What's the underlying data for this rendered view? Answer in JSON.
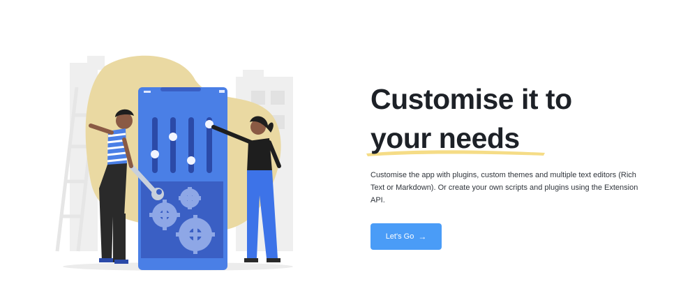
{
  "hero": {
    "heading_line1": "Customise it to",
    "heading_line2": "your needs",
    "description": "Customise the app with plugins, custom themes and multiple text editors (Rich Text or Markdown). Or create your own scripts and plugins using the Extension API.",
    "cta_label": "Let's Go",
    "cta_icon": "arrow-right-icon"
  },
  "illustration": {
    "subject": "two people adjusting slider controls and gears on a giant phone",
    "icons": [
      "phone-icon",
      "slider-icon",
      "gear-icon",
      "wrench-icon"
    ]
  },
  "colors": {
    "accent": "#4a9cf7",
    "highlight": "#f5dc86",
    "blob": "#ead9a2",
    "phone": "#4a7fe6",
    "phone_screen": "#3a5fc4",
    "heading": "#1d2127"
  }
}
